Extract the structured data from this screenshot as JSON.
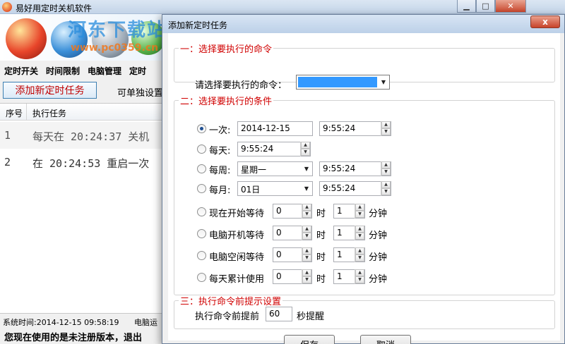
{
  "main_window": {
    "title": "易好用定时关机软件",
    "watermark": {
      "text": "河东下载站",
      "url": "www.pc0359.cn"
    },
    "nav": [
      "定时开关",
      "时间限制",
      "电脑管理",
      "定时"
    ],
    "add_task_button": "添加新定时任务",
    "single_setting": "可单独设置",
    "table": {
      "columns": [
        "序号",
        "执行任务"
      ],
      "rows": [
        {
          "index": "1",
          "task": "每天在 20:24:37 关机"
        },
        {
          "index": "2",
          "task": "在 20:24:53 重启一次"
        }
      ]
    },
    "status": {
      "system_time": "系统时间:2014-12-15 09:58:19",
      "pc": "电脑运"
    },
    "notice": "您现在使用的是未注册版本，退出"
  },
  "dialog": {
    "title": "添加新定时任务",
    "close_label": "x",
    "command_group": {
      "legend": "一：选择要执行的命令",
      "label": "请选择要执行的命令："
    },
    "condition_group": {
      "legend": "二：选择要执行的条件",
      "once": {
        "label": "一次:",
        "date": "2014-12-15",
        "time": "9:55:24"
      },
      "daily": {
        "label": "每天:",
        "time": "9:55:24"
      },
      "weekly": {
        "label": "每周:",
        "day": "星期一",
        "time": "9:55:24"
      },
      "monthly": {
        "label": "每月:",
        "day": "01日",
        "time": "9:55:24"
      },
      "waits": [
        {
          "label": "现在开始等待",
          "hours": "0",
          "hour_unit": "时",
          "minutes": "1",
          "minute_unit": "分钟"
        },
        {
          "label": "电脑开机等待",
          "hours": "0",
          "hour_unit": "时",
          "minutes": "1",
          "minute_unit": "分钟"
        },
        {
          "label": "电脑空闲等待",
          "hours": "0",
          "hour_unit": "时",
          "minutes": "1",
          "minute_unit": "分钟"
        },
        {
          "label": "每天累计使用",
          "hours": "0",
          "hour_unit": "时",
          "minutes": "1",
          "minute_unit": "分钟"
        }
      ]
    },
    "prompt_group": {
      "legend": "三：执行命令前提示设置",
      "prefix": "执行命令前提前",
      "seconds": "60",
      "suffix": "秒提醒"
    },
    "save_label": "保存",
    "cancel_label": "取消",
    "spin_up": "▲",
    "spin_down": "▼",
    "combo_arrow": "▼"
  },
  "colors": {
    "legend_red": "#d00000",
    "selection_blue": "#3399ff",
    "add_button_text": "#c00000"
  }
}
